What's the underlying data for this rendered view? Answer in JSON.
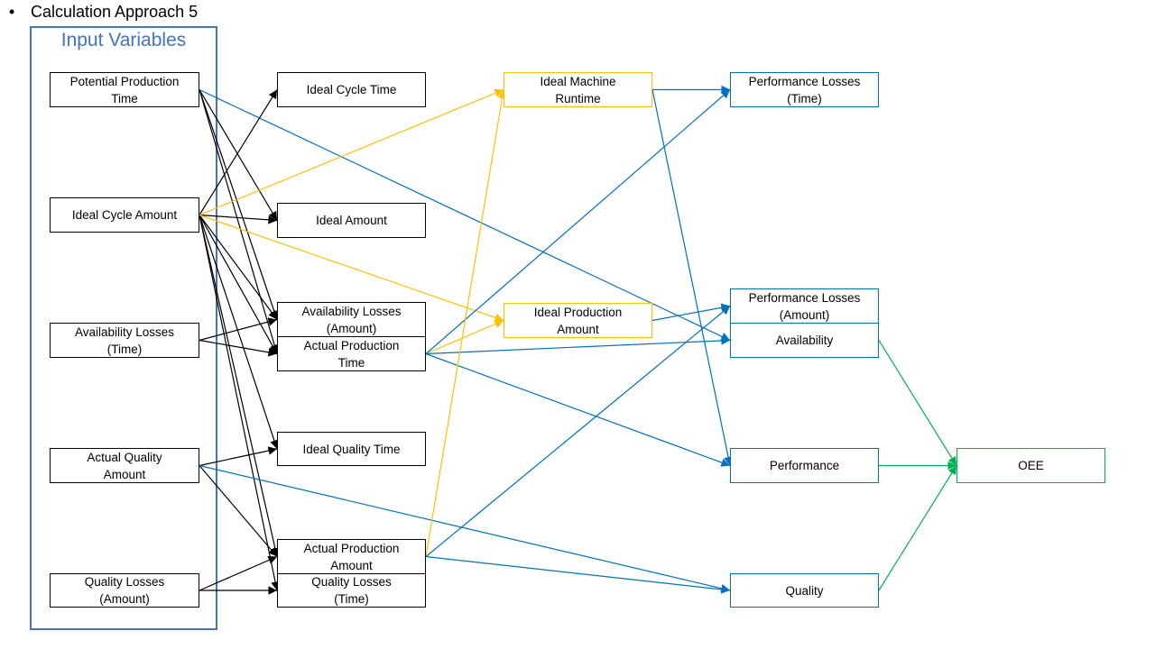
{
  "slide": {
    "bullet": "•",
    "heading": "Calculation Approach 5",
    "input_group_title": "Input Variables"
  },
  "colors": {
    "input_frame": "#4472c4",
    "input_edge": "#000000",
    "machine_edge": "#ffc000",
    "metric_edge": "#0070c0",
    "oee_edge": "#00b050"
  },
  "nodes": {
    "potential_production_time": "Potential Production\nTime",
    "ideal_cycle_amount": "Ideal Cycle Amount",
    "availability_losses_time": "Availability Losses\n(Time)",
    "actual_quality_amount": "Actual Quality\nAmount",
    "quality_losses_amount": "Quality Losses\n(Amount)",
    "ideal_cycle_time": "Ideal Cycle Time",
    "ideal_amount": "Ideal Amount",
    "availability_losses_amount": "Availability Losses\n(Amount)",
    "actual_production_time": "Actual Production\nTime",
    "ideal_quality_time": "Ideal Quality Time",
    "actual_production_amount": "Actual Production\nAmount",
    "quality_losses_time": "Quality Losses\n(Time)",
    "ideal_machine_runtime": "Ideal Machine\nRuntime",
    "ideal_production_amount": "Ideal Production\nAmount",
    "performance_losses_time": "Performance  Losses\n(Time)",
    "performance_losses_amount": "Performance  Losses\n(Amount)",
    "availability": "Availability",
    "performance": "Performance",
    "quality": "Quality",
    "oee": "OEE"
  },
  "edges": [
    {
      "from": "potential_production_time",
      "to": "ideal_amount",
      "color": "black"
    },
    {
      "from": "potential_production_time",
      "to": "actual_production_time",
      "color": "black"
    },
    {
      "from": "potential_production_time",
      "to": "availability_losses_amount",
      "color": "black"
    },
    {
      "from": "potential_production_time",
      "to": "availability",
      "color": "blue"
    },
    {
      "from": "ideal_cycle_amount",
      "to": "ideal_cycle_time",
      "color": "black"
    },
    {
      "from": "ideal_cycle_amount",
      "to": "ideal_amount",
      "color": "black"
    },
    {
      "from": "ideal_cycle_amount",
      "to": "availability_losses_amount",
      "color": "black"
    },
    {
      "from": "ideal_cycle_amount",
      "to": "actual_production_time",
      "color": "black"
    },
    {
      "from": "ideal_cycle_amount",
      "to": "ideal_quality_time",
      "color": "black"
    },
    {
      "from": "ideal_cycle_amount",
      "to": "actual_production_amount",
      "color": "black"
    },
    {
      "from": "ideal_cycle_amount",
      "to": "quality_losses_time",
      "color": "black"
    },
    {
      "from": "ideal_cycle_amount",
      "to": "ideal_machine_runtime",
      "color": "orange"
    },
    {
      "from": "ideal_cycle_amount",
      "to": "ideal_production_amount",
      "color": "orange"
    },
    {
      "from": "availability_losses_time",
      "to": "availability_losses_amount",
      "color": "black"
    },
    {
      "from": "availability_losses_time",
      "to": "actual_production_time",
      "color": "black"
    },
    {
      "from": "actual_quality_amount",
      "to": "ideal_quality_time",
      "color": "black"
    },
    {
      "from": "actual_quality_amount",
      "to": "actual_production_amount",
      "color": "black"
    },
    {
      "from": "actual_quality_amount",
      "to": "quality",
      "color": "blue"
    },
    {
      "from": "quality_losses_amount",
      "to": "actual_production_amount",
      "color": "black"
    },
    {
      "from": "quality_losses_amount",
      "to": "quality_losses_time",
      "color": "black"
    },
    {
      "from": "actual_production_time",
      "to": "ideal_production_amount",
      "color": "orange"
    },
    {
      "from": "actual_production_time",
      "to": "performance_losses_time",
      "color": "blue"
    },
    {
      "from": "actual_production_time",
      "to": "availability",
      "color": "blue"
    },
    {
      "from": "actual_production_time",
      "to": "performance",
      "color": "blue"
    },
    {
      "from": "actual_production_amount",
      "to": "ideal_machine_runtime",
      "color": "orange"
    },
    {
      "from": "actual_production_amount",
      "to": "performance_losses_amount",
      "color": "blue"
    },
    {
      "from": "actual_production_amount",
      "to": "quality",
      "color": "blue"
    },
    {
      "from": "ideal_machine_runtime",
      "to": "performance_losses_time",
      "color": "blue"
    },
    {
      "from": "ideal_machine_runtime",
      "to": "performance",
      "color": "blue"
    },
    {
      "from": "ideal_production_amount",
      "to": "performance_losses_amount",
      "color": "blue"
    },
    {
      "from": "availability",
      "to": "oee",
      "color": "green"
    },
    {
      "from": "performance",
      "to": "oee",
      "color": "green"
    },
    {
      "from": "quality",
      "to": "oee",
      "color": "green"
    }
  ]
}
